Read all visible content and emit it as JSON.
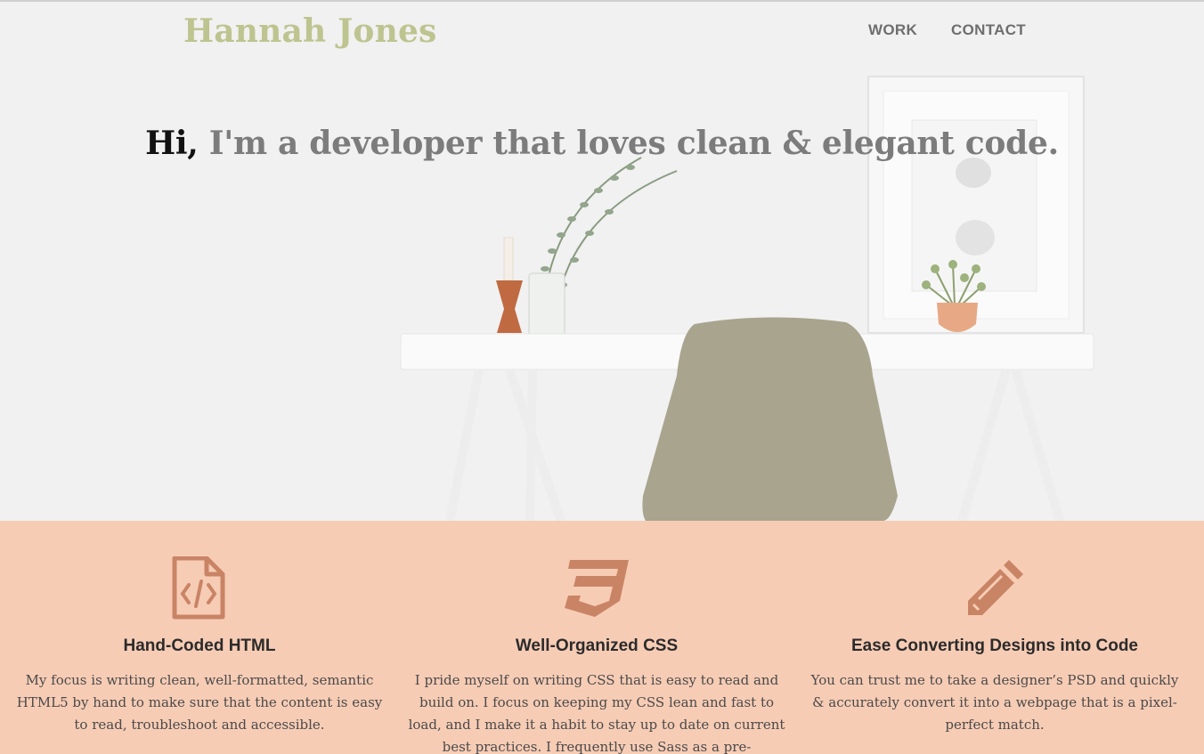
{
  "header": {
    "brand": "Hannah Jones",
    "nav": [
      {
        "label": "WORK"
      },
      {
        "label": "CONTACT"
      }
    ]
  },
  "hero": {
    "headline_hi": "Hi,",
    "headline_rest": " I'm a developer that loves clean & elegant code."
  },
  "features": [
    {
      "icon": "file-code-icon",
      "title": "Hand-Coded HTML",
      "text": "My focus is writing clean, well-formatted, semantic HTML5 by hand to make sure that the content is easy to read, troubleshoot and accessible."
    },
    {
      "icon": "css3-icon",
      "title": "Well-Organized CSS",
      "text": "I pride myself on writing CSS that is easy to read and build on. I focus on keeping my CSS lean and fast to load, and I make it a habit to stay up to date on current best practices. I frequently use Sass as a pre-processor."
    },
    {
      "icon": "pencil-icon",
      "title": "Ease Converting Designs into Code",
      "text": "You can trust me to take a designer’s PSD and quickly & accurately convert it into a webpage that is a pixel-perfect match."
    }
  ],
  "colors": {
    "brand": "#bec48f",
    "features_bg": "#f7ccb5",
    "icon": "#c98466"
  }
}
